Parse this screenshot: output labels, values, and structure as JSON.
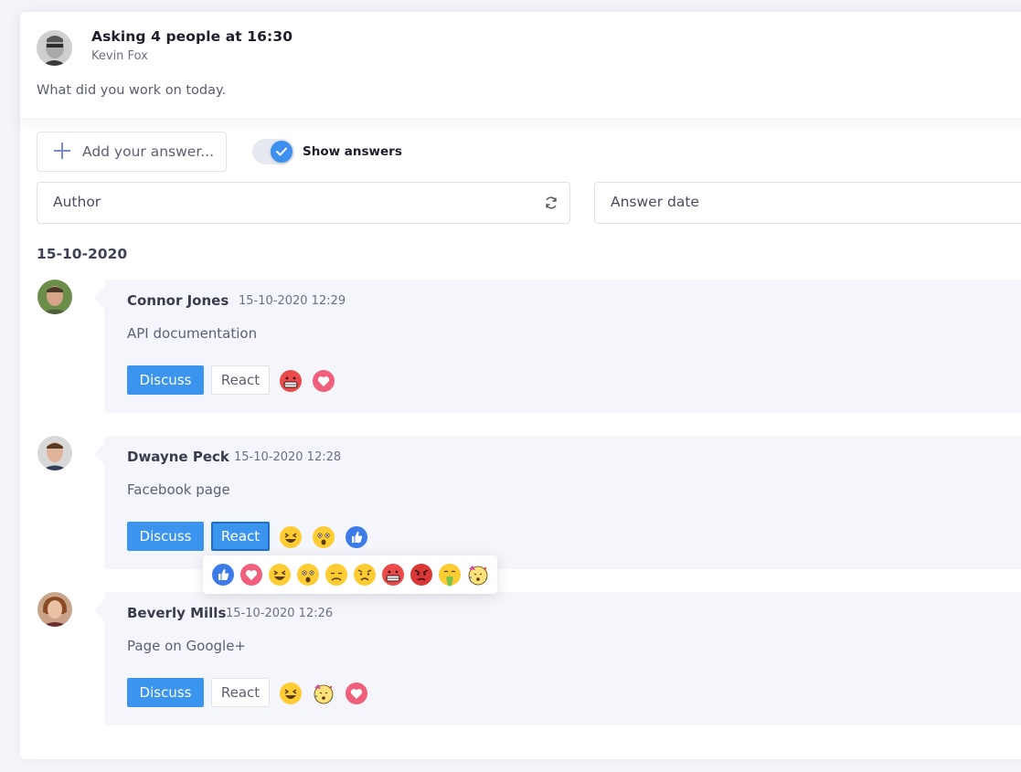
{
  "question": {
    "title": "Asking 4 people at 16:30",
    "author": "Kevin Fox",
    "text": "What did you work on today."
  },
  "toolbar": {
    "add_answer_label": "Add your answer...",
    "show_answers_label": "Show answers",
    "show_answers_on": true
  },
  "filters": {
    "author_label": "Author",
    "answer_date_label": "Answer date"
  },
  "date_group": "15-10-2020",
  "answers": [
    {
      "name": "Connor Jones",
      "date": "15-10-2020 12:29",
      "text": "API documentation",
      "discuss_label": "Discuss",
      "react_label": "React",
      "reactions": [
        "gritted-teeth-emoji",
        "heart-emoji"
      ]
    },
    {
      "name": "Dwayne Peck",
      "date": "15-10-2020 12:28",
      "text": "Facebook page",
      "discuss_label": "Discuss",
      "react_label": "React",
      "react_active": true,
      "reactions": [
        "laughing-emoji",
        "astonished-emoji",
        "thumbs-up-emoji"
      ]
    },
    {
      "name": "Beverly Mills",
      "date": "15-10-2020 12:26",
      "text": "Page on Google+",
      "discuss_label": "Discuss",
      "react_label": "React",
      "reactions": [
        "laughing-emoji",
        "party-emoji",
        "heart-emoji"
      ]
    }
  ],
  "reaction_picker": [
    "thumbs-up-emoji",
    "heart-emoji",
    "laughing-emoji",
    "astonished-emoji",
    "disappointed-emoji",
    "persevering-emoji",
    "gritted-teeth-emoji",
    "angry-emoji",
    "nauseated-emoji",
    "party-emoji"
  ],
  "colors": {
    "accent": "#3b95ee",
    "bubble": "#f5f6fb",
    "heart": "#f0607d",
    "thumbs": "#3d7be8"
  }
}
